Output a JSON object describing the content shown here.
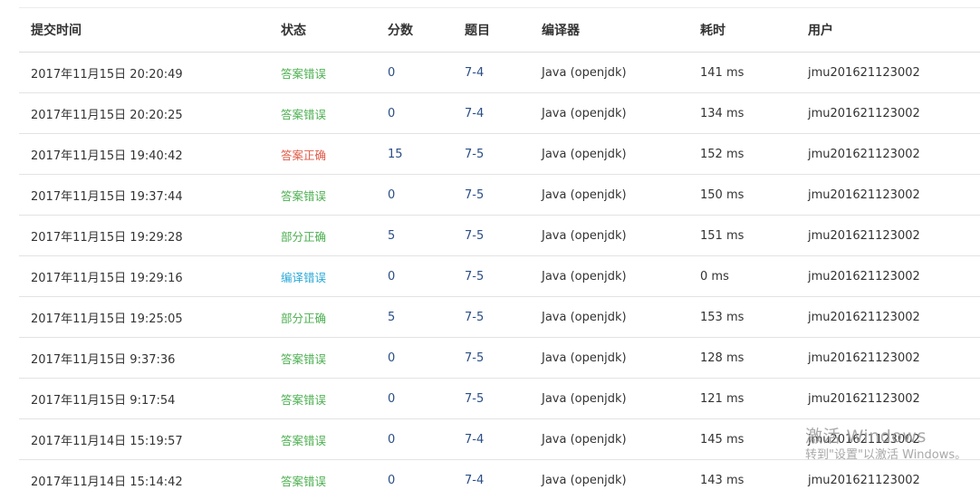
{
  "columns": {
    "time": "提交时间",
    "status": "状态",
    "score": "分数",
    "problem": "题目",
    "compiler": "编译器",
    "cost": "耗时",
    "user": "用户"
  },
  "status_colors": {
    "答案错误": "#4caf50",
    "答案正确": "#e05a47",
    "部分正确": "#4caf50",
    "编译错误": "#2aa9d8"
  },
  "rows": [
    {
      "time": "2017年11月15日 20:20:49",
      "status": "答案错误",
      "score": "0",
      "problem": "7-4",
      "compiler": "Java (openjdk)",
      "cost": "141 ms",
      "user": "jmu201621123002"
    },
    {
      "time": "2017年11月15日 20:20:25",
      "status": "答案错误",
      "score": "0",
      "problem": "7-4",
      "compiler": "Java (openjdk)",
      "cost": "134 ms",
      "user": "jmu201621123002"
    },
    {
      "time": "2017年11月15日 19:40:42",
      "status": "答案正确",
      "score": "15",
      "problem": "7-5",
      "compiler": "Java (openjdk)",
      "cost": "152 ms",
      "user": "jmu201621123002"
    },
    {
      "time": "2017年11月15日 19:37:44",
      "status": "答案错误",
      "score": "0",
      "problem": "7-5",
      "compiler": "Java (openjdk)",
      "cost": "150 ms",
      "user": "jmu201621123002"
    },
    {
      "time": "2017年11月15日 19:29:28",
      "status": "部分正确",
      "score": "5",
      "problem": "7-5",
      "compiler": "Java (openjdk)",
      "cost": "151 ms",
      "user": "jmu201621123002"
    },
    {
      "time": "2017年11月15日 19:29:16",
      "status": "编译错误",
      "score": "0",
      "problem": "7-5",
      "compiler": "Java (openjdk)",
      "cost": "0 ms",
      "user": "jmu201621123002"
    },
    {
      "time": "2017年11月15日 19:25:05",
      "status": "部分正确",
      "score": "5",
      "problem": "7-5",
      "compiler": "Java (openjdk)",
      "cost": "153 ms",
      "user": "jmu201621123002"
    },
    {
      "time": "2017年11月15日 9:37:36",
      "status": "答案错误",
      "score": "0",
      "problem": "7-5",
      "compiler": "Java (openjdk)",
      "cost": "128 ms",
      "user": "jmu201621123002"
    },
    {
      "time": "2017年11月15日 9:17:54",
      "status": "答案错误",
      "score": "0",
      "problem": "7-5",
      "compiler": "Java (openjdk)",
      "cost": "121 ms",
      "user": "jmu201621123002"
    },
    {
      "time": "2017年11月14日 15:19:57",
      "status": "答案错误",
      "score": "0",
      "problem": "7-4",
      "compiler": "Java (openjdk)",
      "cost": "145 ms",
      "user": "jmu201621123002"
    },
    {
      "time": "2017年11月14日 15:14:42",
      "status": "答案错误",
      "score": "0",
      "problem": "7-4",
      "compiler": "Java (openjdk)",
      "cost": "143 ms",
      "user": "jmu201621123002"
    }
  ],
  "watermark": {
    "title": "激活 Windows",
    "subtitle": "转到\"设置\"以激活 Windows。"
  }
}
